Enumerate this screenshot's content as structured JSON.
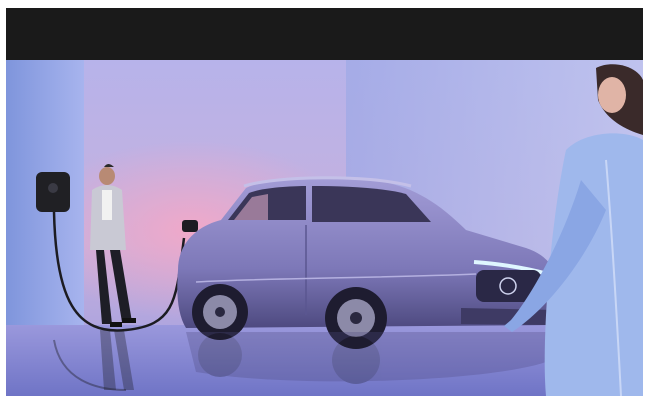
{
  "photo": {
    "subject": "electric-suv-charging",
    "colors": {
      "band": "#1a1a1a",
      "wall_left": "#8fa3e0",
      "wall_back": "#b9b2e6",
      "glow": "#e8a3c6",
      "floor": "#8c8fd6",
      "car_body": "#8a86c4",
      "car_dark": "#3a3658",
      "headlight": "#dff6ff",
      "charger": "#202024"
    }
  }
}
